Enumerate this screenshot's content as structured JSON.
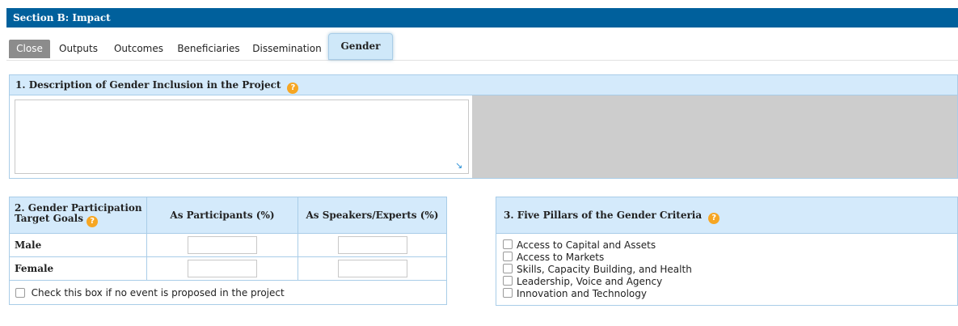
{
  "section": {
    "title": "Section B: Impact"
  },
  "tabs": [
    {
      "label": "Close"
    },
    {
      "label": "Outputs"
    },
    {
      "label": "Outcomes"
    },
    {
      "label": "Beneficiaries"
    },
    {
      "label": "Dissemination"
    },
    {
      "label": "Gender"
    }
  ],
  "active_tab": "Gender",
  "description": {
    "title": "1. Description of Gender Inclusion in the Project",
    "help_icon": "?",
    "value": ""
  },
  "goals": {
    "title": "2. Gender Participation Target Goals",
    "help_icon": "?",
    "col_participants": "As Participants (%)",
    "col_speakers": "As Speakers/Experts (%)",
    "rows": [
      {
        "label": "Male",
        "participants": "",
        "speakers": ""
      },
      {
        "label": "Female",
        "participants": "",
        "speakers": ""
      }
    ],
    "no_event_label": "Check this box if no event is proposed in the project",
    "no_event_checked": false
  },
  "pillars": {
    "title": "3. Five Pillars of the Gender Criteria",
    "help_icon": "?",
    "items": [
      {
        "label": "Access to Capital and Assets",
        "checked": false
      },
      {
        "label": "Access to Markets",
        "checked": false
      },
      {
        "label": "Skills, Capacity Building, and Health",
        "checked": false
      },
      {
        "label": "Leadership, Voice and Agency",
        "checked": false
      },
      {
        "label": "Innovation and Technology",
        "checked": false
      }
    ]
  },
  "colors": {
    "section_bar": "#00609c",
    "panel_header": "#d4eafb",
    "panel_border": "#a9cde8",
    "help_icon": "#f6a623",
    "close_tab": "#8c8c8c"
  }
}
